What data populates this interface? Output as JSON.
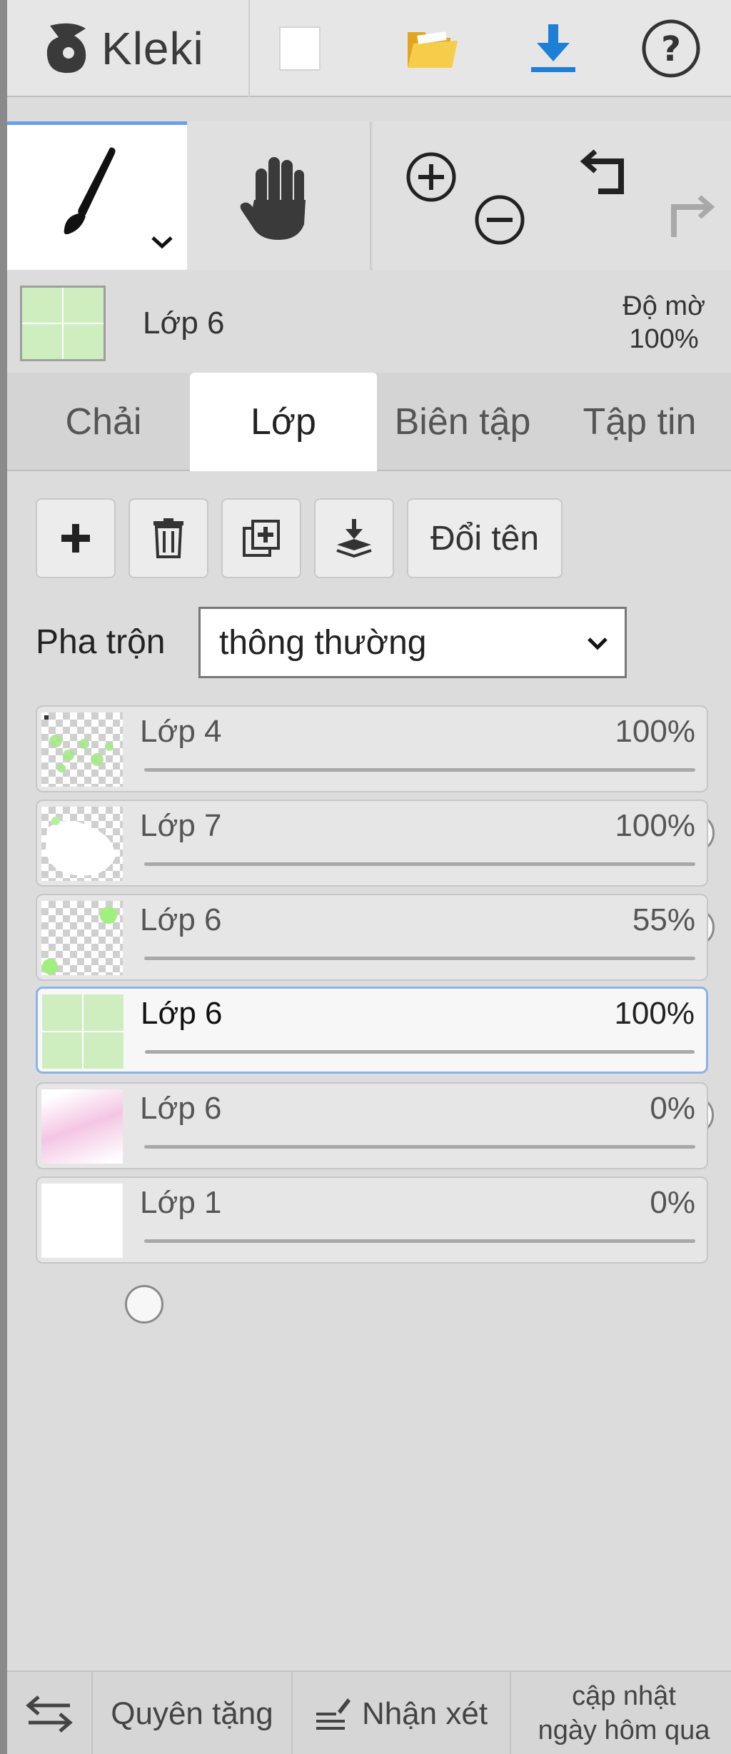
{
  "app": {
    "name": "Kleki"
  },
  "header": {
    "icons": [
      "new-image-icon",
      "open-folder-icon",
      "download-icon",
      "help-icon"
    ]
  },
  "toolbar": {
    "tools": [
      "brush-icon",
      "hand-icon",
      "zoom-in-icon",
      "zoom-out-icon",
      "undo-icon",
      "redo-icon"
    ]
  },
  "current_layer": {
    "name": "Lớp 6",
    "opacity_label": "Độ mờ",
    "opacity_value": "100%"
  },
  "tabs": [
    {
      "label": "Chải",
      "active": false
    },
    {
      "label": "Lớp",
      "active": true
    },
    {
      "label": "Biên tập",
      "active": false
    },
    {
      "label": "Tập tin",
      "active": false
    }
  ],
  "layer_actions": {
    "add_icon": "plus-icon",
    "delete_icon": "trash-icon",
    "duplicate_icon": "duplicate-icon",
    "merge_icon": "merge-down-icon",
    "rename_label": "Đổi tên"
  },
  "blend": {
    "label": "Pha trộn",
    "value": "thông thường"
  },
  "layers": [
    {
      "name": "Lớp 4",
      "opacity_text": "100%",
      "opacity": 1.0,
      "active": false
    },
    {
      "name": "Lớp 7",
      "opacity_text": "100%",
      "opacity": 1.0,
      "active": false
    },
    {
      "name": "Lớp 6",
      "opacity_text": "55%",
      "opacity": 0.55,
      "active": false
    },
    {
      "name": "Lớp 6",
      "opacity_text": "100%",
      "opacity": 1.0,
      "active": true
    },
    {
      "name": "Lớp 6",
      "opacity_text": "0%",
      "opacity": 0.0,
      "active": false
    },
    {
      "name": "Lớp 1",
      "opacity_text": "0%",
      "opacity": 0.0,
      "active": false
    }
  ],
  "footer": {
    "swap_icon": "swap-arrows-icon",
    "donate_label": "Quyên tặng",
    "feedback_label": "Nhận xét",
    "news_line1": "cập nhật",
    "news_line2": "ngày hôm qua"
  },
  "colors": {
    "accent": "#6d9ee6",
    "active_border": "#8db2e8",
    "folder": "#f3c33a",
    "download": "#1e7fd6"
  }
}
